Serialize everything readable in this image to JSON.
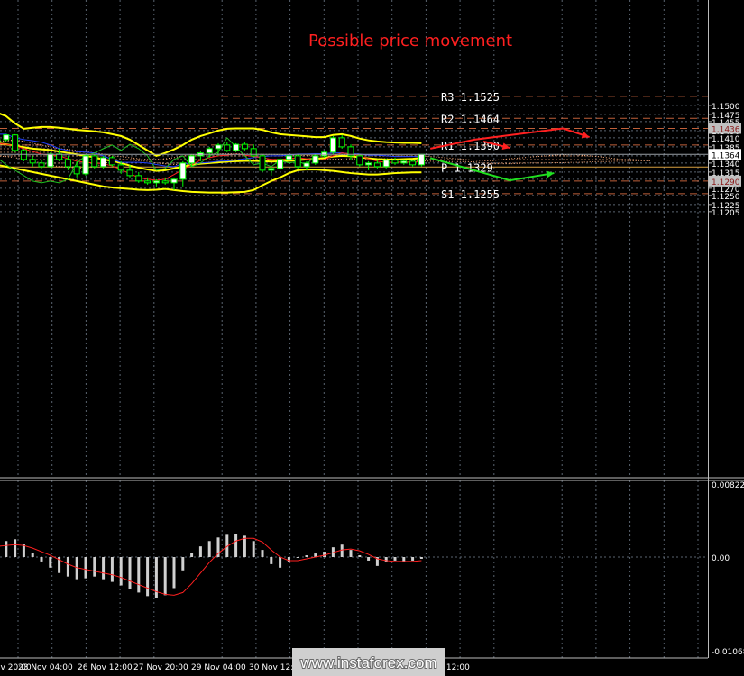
{
  "colors": {
    "background": "#000000",
    "grid": "#5a6470",
    "axis_text": "#ffffff",
    "bull_candle": "#ffffff",
    "bear_candle": "#000000",
    "candle_outline": "#00ff00",
    "bollinger": "#ffff00",
    "tenkan": "#ff2020",
    "kijun": "#2040ff",
    "chikou": "#20c020",
    "kumo": "#ffb080",
    "pivot_levels": "#c0603a",
    "pivot_line": "#d8a040",
    "annotation": "#ff2020",
    "arrow_up": "#ff2020",
    "arrow_down": "#20e020",
    "macd_hist": "#d0d0d0",
    "macd_signal": "#ff2020",
    "price_tag_bg": "#c0c0c0"
  },
  "annotation": "Possible price movement",
  "watermark": "www.instaforex.com",
  "chart_data": [
    {
      "type": "candlestick",
      "title": "",
      "ylim": [
        1.12,
        1.1525
      ],
      "y_ticks": [
        "1.1500",
        "1.1475",
        "1.1455",
        "1.1430",
        "1.1410",
        "1.1385",
        "1.1360",
        "1.1340",
        "1.1315",
        "1.1295",
        "1.1270",
        "1.1250",
        "1.1225",
        "1.1205"
      ],
      "x_ticks": [
        "22 Nov 20:00",
        "23 Nov 04:00",
        "26 Nov 12:00",
        "27 Nov 20:00",
        "29 Nov 04:00",
        "30 Nov 12:00",
        "3 Dec 20:00",
        "5 Dec 04:00",
        "6 Dec 12:00"
      ],
      "current_price": "1.1364",
      "price_tags": [
        {
          "label": "1.1436",
          "value": 1.1436
        },
        {
          "label": "1.1290",
          "value": 1.129
        }
      ],
      "levels": [
        {
          "label": "R3 1.1525",
          "value": 1.1525,
          "style": "dashed"
        },
        {
          "label": "R2 1.1464",
          "value": 1.1464,
          "style": "dashed"
        },
        {
          "label": "",
          "value": 1.1436,
          "style": "dashed"
        },
        {
          "label": "R1 1.1390",
          "value": 1.139,
          "style": "dashed"
        },
        {
          "label": "P 1.1329",
          "value": 1.1329,
          "style": "solid"
        },
        {
          "label": "",
          "value": 1.129,
          "style": "dashed"
        },
        {
          "label": "S1 1.1255",
          "value": 1.1255,
          "style": "dashed"
        }
      ],
      "candles": [
        [
          1.14,
          1.141,
          1.1392,
          1.1405
        ],
        [
          1.1405,
          1.142,
          1.14,
          1.1418
        ],
        [
          1.1418,
          1.142,
          1.137,
          1.1375
        ],
        [
          1.1375,
          1.138,
          1.1345,
          1.135
        ],
        [
          1.135,
          1.136,
          1.133,
          1.134
        ],
        [
          1.134,
          1.135,
          1.1325,
          1.133
        ],
        [
          1.133,
          1.137,
          1.1328,
          1.1365
        ],
        [
          1.1365,
          1.138,
          1.1345,
          1.135
        ],
        [
          1.135,
          1.136,
          1.132,
          1.133
        ],
        [
          1.133,
          1.1345,
          1.13,
          1.131
        ],
        [
          1.131,
          1.1365,
          1.1305,
          1.136
        ],
        [
          1.136,
          1.1365,
          1.1325,
          1.133
        ],
        [
          1.133,
          1.136,
          1.1325,
          1.1355
        ],
        [
          1.1355,
          1.136,
          1.133,
          1.1335
        ],
        [
          1.1335,
          1.1345,
          1.131,
          1.132
        ],
        [
          1.132,
          1.1335,
          1.13,
          1.1305
        ],
        [
          1.1305,
          1.1315,
          1.1285,
          1.129
        ],
        [
          1.129,
          1.13,
          1.128,
          1.1285
        ],
        [
          1.1285,
          1.1295,
          1.1275,
          1.129
        ],
        [
          1.129,
          1.13,
          1.128,
          1.1285
        ],
        [
          1.1285,
          1.13,
          1.1265,
          1.1295
        ],
        [
          1.1295,
          1.1345,
          1.1275,
          1.134
        ],
        [
          1.134,
          1.1365,
          1.133,
          1.136
        ],
        [
          1.136,
          1.1372,
          1.1345,
          1.1368
        ],
        [
          1.1368,
          1.1385,
          1.1355,
          1.138
        ],
        [
          1.138,
          1.1395,
          1.136,
          1.139
        ],
        [
          1.139,
          1.1398,
          1.137,
          1.1375
        ],
        [
          1.1375,
          1.1395,
          1.137,
          1.1392
        ],
        [
          1.1392,
          1.1398,
          1.1375,
          1.138
        ],
        [
          1.138,
          1.1392,
          1.1355,
          1.136
        ],
        [
          1.136,
          1.1365,
          1.1315,
          1.132
        ],
        [
          1.132,
          1.133,
          1.1305,
          1.1325
        ],
        [
          1.1325,
          1.1355,
          1.132,
          1.135
        ],
        [
          1.135,
          1.1365,
          1.134,
          1.136
        ],
        [
          1.136,
          1.1365,
          1.1325,
          1.133
        ],
        [
          1.133,
          1.1345,
          1.132,
          1.134
        ],
        [
          1.134,
          1.1365,
          1.1335,
          1.136
        ],
        [
          1.136,
          1.1375,
          1.1355,
          1.137
        ],
        [
          1.137,
          1.1415,
          1.1365,
          1.141
        ],
        [
          1.141,
          1.1418,
          1.138,
          1.1385
        ],
        [
          1.1385,
          1.1392,
          1.135,
          1.136
        ],
        [
          1.136,
          1.1365,
          1.133,
          1.1335
        ],
        [
          1.1335,
          1.1345,
          1.132,
          1.134
        ],
        [
          1.134,
          1.135,
          1.1325,
          1.133
        ],
        [
          1.133,
          1.1352,
          1.1325,
          1.1348
        ],
        [
          1.1348,
          1.1355,
          1.1335,
          1.134
        ],
        [
          1.134,
          1.135,
          1.1335,
          1.1345
        ],
        [
          1.1345,
          1.1348,
          1.133,
          1.1335
        ],
        [
          1.1335,
          1.1365,
          1.133,
          1.1364
        ]
      ],
      "bollinger": {
        "upper": [
          1.148,
          1.147,
          1.145,
          1.1435,
          1.1438,
          1.144,
          1.144,
          1.1438,
          1.1435,
          1.1432,
          1.143,
          1.1428,
          1.1425,
          1.142,
          1.1415,
          1.1405,
          1.139,
          1.1375,
          1.136,
          1.1368,
          1.1378,
          1.139,
          1.1405,
          1.1415,
          1.1422,
          1.143,
          1.1435,
          1.1436,
          1.1436,
          1.1436,
          1.1432,
          1.1425,
          1.142,
          1.1418,
          1.1416,
          1.1414,
          1.1412,
          1.1412,
          1.1418,
          1.142,
          1.1415,
          1.1408,
          1.1403,
          1.14,
          1.1398,
          1.1397,
          1.1396,
          1.1396,
          1.1395
        ],
        "middle": [
          1.1395,
          1.1392,
          1.1388,
          1.1384,
          1.138,
          1.1378,
          1.1376,
          1.1372,
          1.1368,
          1.1364,
          1.136,
          1.1356,
          1.135,
          1.1346,
          1.134,
          1.1333,
          1.1327,
          1.1322,
          1.1318,
          1.132,
          1.1325,
          1.133,
          1.1335,
          1.1338,
          1.134,
          1.1342,
          1.1344,
          1.1345,
          1.1346,
          1.1346,
          1.1345,
          1.1344,
          1.1345,
          1.1346,
          1.1348,
          1.135,
          1.1352,
          1.1354,
          1.1358,
          1.136,
          1.1359,
          1.1356,
          1.1353,
          1.1351,
          1.135,
          1.135,
          1.1351,
          1.1352,
          1.1354
        ],
        "lower": [
          1.1335,
          1.133,
          1.1325,
          1.132,
          1.1315,
          1.131,
          1.1305,
          1.13,
          1.1295,
          1.129,
          1.1285,
          1.128,
          1.1275,
          1.1272,
          1.127,
          1.1268,
          1.1266,
          1.1265,
          1.1266,
          1.1268,
          1.1265,
          1.1262,
          1.126,
          1.1259,
          1.1258,
          1.1258,
          1.1258,
          1.1259,
          1.126,
          1.1265,
          1.1278,
          1.129,
          1.13,
          1.1312,
          1.132,
          1.1322,
          1.1322,
          1.132,
          1.1318,
          1.1315,
          1.1312,
          1.131,
          1.1308,
          1.1308,
          1.131,
          1.1312,
          1.1313,
          1.1314,
          1.1314
        ]
      },
      "tenkan": [
        1.1395,
        1.1392,
        1.1388,
        1.138,
        1.1372,
        1.1365,
        1.1362,
        1.136,
        1.1352,
        1.1345,
        1.1342,
        1.134,
        1.1338,
        1.1332,
        1.1322,
        1.131,
        1.13,
        1.1295,
        1.1292,
        1.1295,
        1.1308,
        1.1322,
        1.1335,
        1.1348,
        1.1355,
        1.136,
        1.1362,
        1.1365,
        1.1362,
        1.1358,
        1.1355,
        1.135,
        1.135,
        1.1352,
        1.1355,
        1.1352,
        1.1348,
        1.135,
        1.136,
        1.1368,
        1.1365,
        1.136,
        1.1352,
        1.1345,
        1.1342,
        1.1342,
        1.1343,
        1.1342,
        1.1345
      ],
      "kijun": [
        1.142,
        1.142,
        1.141,
        1.1405,
        1.1402,
        1.1398,
        1.139,
        1.138,
        1.1375,
        1.1372,
        1.137,
        1.1368,
        1.136,
        1.135,
        1.1342,
        1.1342,
        1.1342,
        1.134,
        1.1336,
        1.1332,
        1.133,
        1.1338,
        1.134,
        1.134,
        1.1342,
        1.1345,
        1.1346,
        1.1348,
        1.1352,
        1.1355,
        1.1358,
        1.136,
        1.136,
        1.1362,
        1.1365,
        1.1365,
        1.1366,
        1.1366,
        1.1368,
        1.1368,
        1.1366,
        1.1365,
        1.1362,
        1.1362,
        1.136,
        1.1358,
        1.1358,
        1.1358,
        1.1358
      ],
      "chikou_offset": 26,
      "kumo": {
        "top": [
          1.14,
          1.1402,
          1.1405,
          1.14,
          1.1395,
          1.139,
          1.1385,
          1.138,
          1.1378,
          1.1375,
          1.1372,
          1.1368,
          1.1365,
          1.136,
          1.1358,
          1.1355,
          1.1352,
          1.135,
          1.135,
          1.1352,
          1.1355,
          1.136,
          1.1362,
          1.1364,
          1.1365,
          1.1365,
          1.1366,
          1.1366,
          1.1365,
          1.1365,
          1.1364,
          1.1364,
          1.1363,
          1.1362,
          1.1361,
          1.1361,
          1.136,
          1.136,
          1.136,
          1.1362,
          1.1364,
          1.1363,
          1.1362,
          1.1362,
          1.1361,
          1.136,
          1.136,
          1.136,
          1.136,
          1.1358,
          1.1356,
          1.1354,
          1.1352,
          1.135,
          1.1348,
          1.1346,
          1.1346,
          1.135,
          1.1352,
          1.1354,
          1.1356,
          1.1358,
          1.136,
          1.1362,
          1.1363,
          1.1364,
          1.1362,
          1.136,
          1.1358,
          1.1355,
          1.1352,
          1.135,
          1.135,
          1.1348,
          1.1347
        ],
        "bottom": [
          1.136,
          1.1358,
          1.1355,
          1.135,
          1.1345,
          1.134,
          1.1335,
          1.133,
          1.1328,
          1.1326,
          1.1325,
          1.133,
          1.1338,
          1.1345,
          1.135,
          1.1348,
          1.1346,
          1.1345,
          1.134,
          1.1338,
          1.1336,
          1.1336,
          1.1338,
          1.134,
          1.1342,
          1.1342,
          1.1342,
          1.1344,
          1.1345,
          1.1346,
          1.1346,
          1.1348,
          1.1348,
          1.1348,
          1.1349,
          1.135,
          1.135,
          1.135,
          1.135,
          1.1351,
          1.1352,
          1.1352,
          1.1352,
          1.1352,
          1.1352,
          1.135,
          1.1348,
          1.1347,
          1.1346,
          1.1345,
          1.1344,
          1.1344,
          1.1344,
          1.1344,
          1.1343,
          1.134,
          1.1338,
          1.1338,
          1.1338,
          1.1339,
          1.134,
          1.134,
          1.134,
          1.1341,
          1.1341,
          1.1342,
          1.1342,
          1.1343,
          1.1344,
          1.1344,
          1.1345,
          1.1345,
          1.1346,
          1.1346,
          1.1346
        ]
      },
      "projections": {
        "up": [
          [
            49,
            1.138
          ],
          [
            54,
            1.1405
          ],
          [
            64,
            1.1436
          ],
          [
            67,
            1.1412
          ]
        ],
        "up_fork": [
          [
            55,
            1.14
          ],
          [
            58,
            1.1382
          ]
        ],
        "down": [
          [
            49,
            1.1354
          ],
          [
            46,
            1.1353
          ],
          [
            61,
            1.129
          ],
          [
            66,
            1.131
          ]
        ]
      }
    },
    {
      "type": "bar",
      "title": "MACD",
      "ylim": [
        -0.01068,
        0.00822
      ],
      "y_ticks": [
        "0.00822",
        "0.00",
        "-0.01068"
      ],
      "values": [
        0.0015,
        0.0018,
        0.002,
        0.0015,
        0.0005,
        -0.0005,
        -0.0012,
        -0.0018,
        -0.0022,
        -0.0025,
        -0.0024,
        -0.0022,
        -0.0025,
        -0.0028,
        -0.0032,
        -0.0036,
        -0.004,
        -0.0044,
        -0.0046,
        -0.0043,
        -0.0035,
        -0.0015,
        0.0005,
        0.0012,
        0.0018,
        0.0022,
        0.0025,
        0.0026,
        0.0024,
        0.0018,
        0.0008,
        -0.0008,
        -0.0012,
        -0.0006,
        -0.0001,
        0.0002,
        0.0004,
        0.0006,
        0.0011,
        0.0014,
        0.0008,
        0.0002,
        -0.0004,
        -0.001,
        -0.0006,
        -0.0004,
        -0.0005,
        -0.0004,
        -0.0002
      ],
      "signal": [
        0.0012,
        0.0013,
        0.0014,
        0.0013,
        0.001,
        0.0006,
        0.0002,
        -0.0003,
        -0.0008,
        -0.0012,
        -0.0014,
        -0.0016,
        -0.0018,
        -0.002,
        -0.0023,
        -0.0027,
        -0.0031,
        -0.0035,
        -0.0039,
        -0.0042,
        -0.0043,
        -0.004,
        -0.003,
        -0.0018,
        -0.0006,
        0.0004,
        0.0012,
        0.0018,
        0.0021,
        0.0021,
        0.0017,
        0.0008,
        0.0,
        -0.0004,
        -0.0004,
        -0.0002,
        0.0,
        0.0002,
        0.0005,
        0.0008,
        0.0009,
        0.0007,
        0.0003,
        -0.0002,
        -0.0004,
        -0.0005,
        -0.0005,
        -0.0005,
        -0.0004
      ]
    }
  ]
}
